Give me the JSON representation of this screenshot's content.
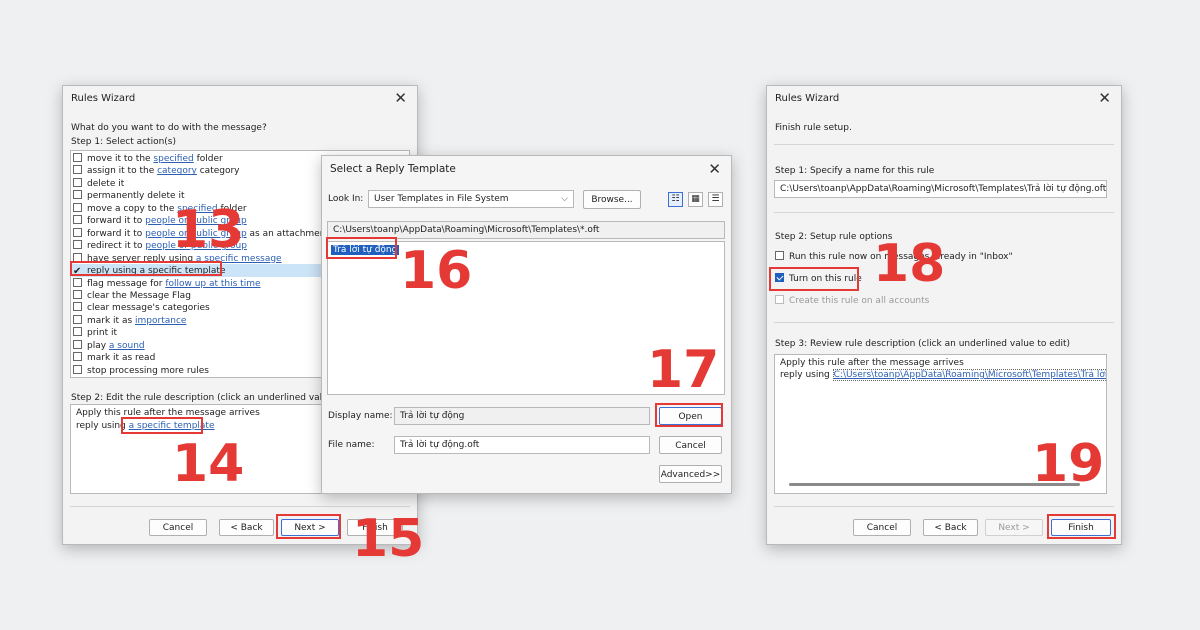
{
  "left": {
    "title": "Rules Wizard",
    "question": "What do you want to do with the message?",
    "step1": "Step 1: Select action(s)",
    "actions": [
      {
        "pre": "move it to the ",
        "link": "specified",
        "post": " folder"
      },
      {
        "pre": "assign it to the ",
        "link": "category",
        "post": " category"
      },
      {
        "pre": "delete it",
        "link": "",
        "post": ""
      },
      {
        "pre": "permanently delete it",
        "link": "",
        "post": ""
      },
      {
        "pre": "move a copy to the ",
        "link": "specified",
        "post": " folder"
      },
      {
        "pre": "forward it to ",
        "link": "people or public group",
        "post": ""
      },
      {
        "pre": "forward it to ",
        "link": "people or public group",
        "post": " as an attachment"
      },
      {
        "pre": "redirect it to ",
        "link": "people or public group",
        "post": ""
      },
      {
        "pre": "have server reply using ",
        "link": "a specific message",
        "post": ""
      },
      {
        "pre": "reply using a specific template",
        "link": "",
        "post": ""
      },
      {
        "pre": "flag message for ",
        "link": "follow up at this time",
        "post": ""
      },
      {
        "pre": "clear the Message Flag",
        "link": "",
        "post": ""
      },
      {
        "pre": "clear message's categories",
        "link": "",
        "post": ""
      },
      {
        "pre": "mark it as ",
        "link": "importance",
        "post": ""
      },
      {
        "pre": "print it",
        "link": "",
        "post": ""
      },
      {
        "pre": "play ",
        "link": "a sound",
        "post": ""
      },
      {
        "pre": "mark it as read",
        "link": "",
        "post": ""
      },
      {
        "pre": "stop processing more rules",
        "link": "",
        "post": ""
      }
    ],
    "step2": "Step 2: Edit the rule description (click an underlined value)",
    "desc_line1": "Apply this rule after the message arrives",
    "desc_line2_pre": "reply using ",
    "desc_line2_link": "a specific template",
    "cancel": "Cancel",
    "back": "< Back",
    "next": "Next >",
    "finish": "Finish"
  },
  "middle": {
    "title": "Select a Reply Template",
    "look_in_label": "Look In:",
    "look_in_value": "User Templates in File System",
    "browse": "Browse...",
    "path": "C:\\Users\\toanp\\AppData\\Roaming\\Microsoft\\Templates\\*.oft",
    "file_item": "Trả lời tự động",
    "display_name_label": "Display name:",
    "display_name_value": "Trả lời tự động",
    "file_name_label": "File name:",
    "file_name_value": "Trả lời tự động.oft",
    "open": "Open",
    "cancel": "Cancel",
    "advanced": "Advanced>>"
  },
  "right": {
    "title": "Rules Wizard",
    "finish_setup": "Finish rule setup.",
    "step1": "Step 1: Specify a name for this rule",
    "name_value": "C:\\Users\\toanp\\AppData\\Roaming\\Microsoft\\Templates\\Trả lời tự động.oft",
    "step2": "Step 2: Setup rule options",
    "opt_run": "Run this rule now on messages already in \"Inbox\"",
    "opt_turn_on": "Turn on this rule",
    "opt_all_accounts": "Create this rule on all accounts",
    "step3": "Step 3: Review rule description (click an underlined value to edit)",
    "desc_line1": "Apply this rule after the message arrives",
    "desc_line2_pre": "reply using ",
    "desc_line2_link": "C:\\Users\\toanp\\AppData\\Roaming\\Microsoft\\Templates\\Trả lời tự động",
    "cancel": "Cancel",
    "back": "< Back",
    "next": "Next >",
    "finish": "Finish"
  },
  "steps": {
    "s13": "13",
    "s14": "14",
    "s15": "15",
    "s16": "16",
    "s17": "17",
    "s18": "18",
    "s19": "19"
  },
  "colors": {
    "highlight": "#e53935",
    "accent": "#1f5fbf",
    "link": "#2b5fb3",
    "background": "#eef0f2"
  }
}
